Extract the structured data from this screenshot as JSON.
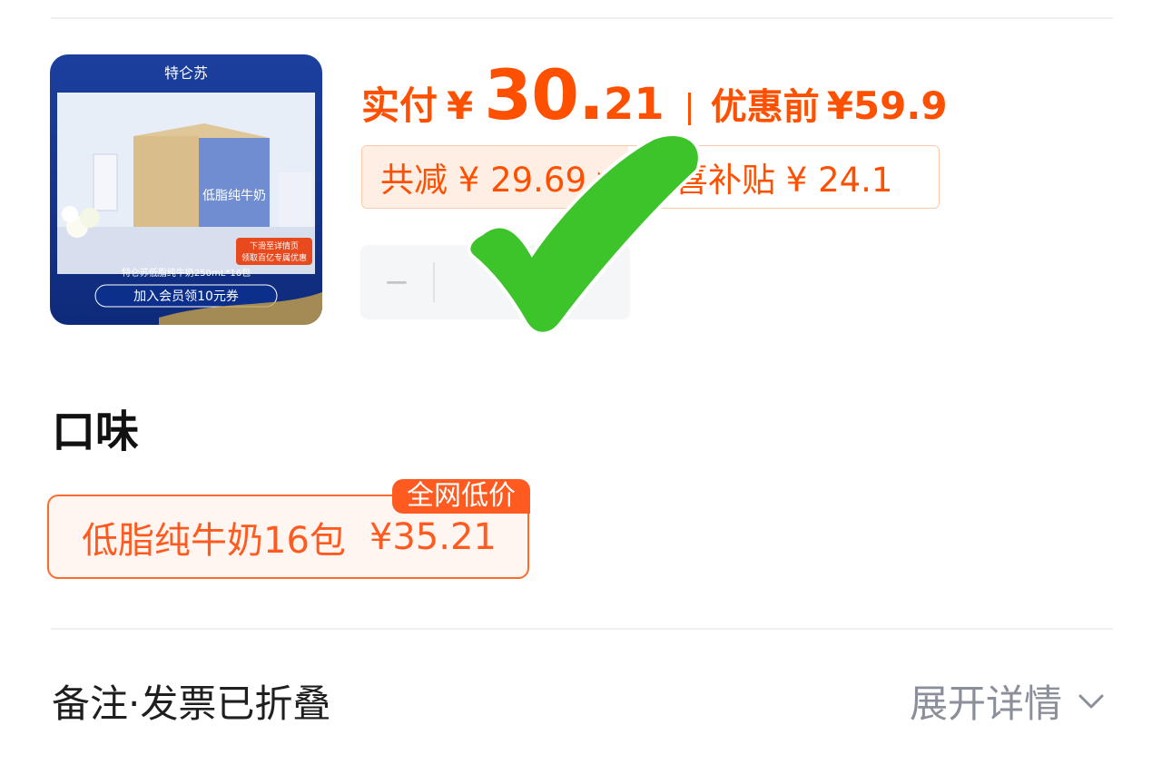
{
  "price": {
    "label": "实付",
    "currency": "¥",
    "integer": "30.",
    "decimal": "21",
    "original_label": "优惠前",
    "original_price": "¥59.9"
  },
  "discount": {
    "total": "共减 ¥ 29.69",
    "subsidy": "惊喜补贴 ¥ 24.1"
  },
  "stepper": {
    "minus": "−",
    "value": ""
  },
  "product_image": {
    "brand": "特仑苏",
    "box_text": "低脂纯牛奶",
    "subtitle": "特仑苏低脂纯牛奶250mL*16包",
    "banner": "加入会员领10元券",
    "promo_line1": "下滑至详情页",
    "promo_line2": "领取百亿专属优惠"
  },
  "flavor": {
    "title": "口味",
    "option_name": "低脂纯牛奶16包",
    "option_price": "¥35.21",
    "badge": "全网低价"
  },
  "footer": {
    "note_label": "备注·发票已折叠",
    "expand_label": "展开详情"
  },
  "colors": {
    "accent": "#ff5000",
    "check": "#3dc42b"
  }
}
